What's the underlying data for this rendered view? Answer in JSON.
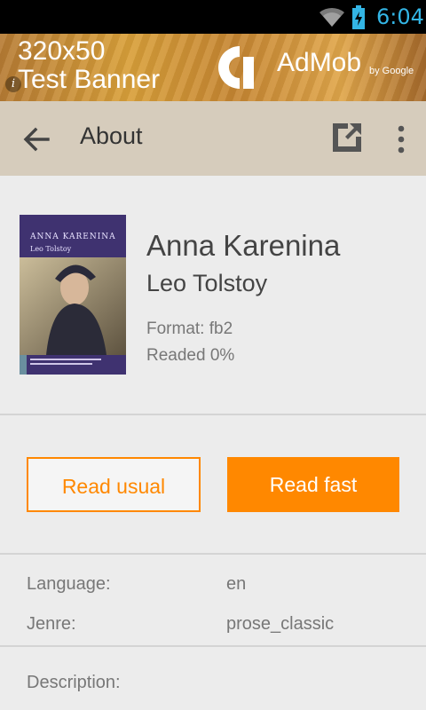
{
  "status_bar": {
    "time": "6:04",
    "wifi_icon": "wifi-icon",
    "battery_icon": "battery-charging-icon",
    "accent_color": "#33b5e5"
  },
  "ad": {
    "test_text_line1": "320x50",
    "test_text_line2": "Test Banner",
    "brand": "AdMob",
    "brand_sub": "by Google",
    "info_icon": "info-icon"
  },
  "toolbar": {
    "title": "About",
    "back_icon": "arrow-back-icon",
    "share_icon": "open-external-icon",
    "overflow_icon": "more-vert-icon",
    "background": "#d6ccbc"
  },
  "book": {
    "cover_title": "ANNA KARENINA",
    "cover_author": "Leo Tolstoy",
    "title": "Anna Karenina",
    "author": "Leo Tolstoy",
    "format": "Format: fb2",
    "progress": "Readed 0%"
  },
  "actions": {
    "read_usual": "Read usual",
    "read_fast": "Read fast",
    "accent": "#ff8800"
  },
  "meta": {
    "language_label": "Language:",
    "language_value": "en",
    "genre_label": "Jenre:",
    "genre_value": "prose_classic",
    "description_label": "Description:"
  }
}
